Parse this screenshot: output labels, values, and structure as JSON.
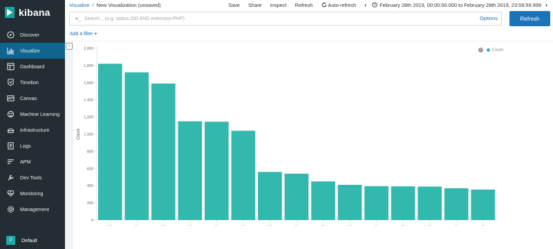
{
  "brand": {
    "name": "kibana"
  },
  "sidebar": {
    "items": [
      {
        "label": "Discover",
        "icon": "compass-icon",
        "active": false
      },
      {
        "label": "Visualize",
        "icon": "chart-icon",
        "active": true
      },
      {
        "label": "Dashboard",
        "icon": "dashboard-icon",
        "active": false
      },
      {
        "label": "Timelion",
        "icon": "timelion-icon",
        "active": false
      },
      {
        "label": "Canvas",
        "icon": "canvas-icon",
        "active": false
      },
      {
        "label": "Machine Learning",
        "icon": "machine-learning-icon",
        "active": false
      },
      {
        "label": "Infrastructure",
        "icon": "infrastructure-icon",
        "active": false
      },
      {
        "label": "Logs",
        "icon": "logs-icon",
        "active": false
      },
      {
        "label": "APM",
        "icon": "apm-icon",
        "active": false
      },
      {
        "label": "Dev Tools",
        "icon": "wrench-icon",
        "active": false
      },
      {
        "label": "Monitoring",
        "icon": "heartbeat-icon",
        "active": false
      },
      {
        "label": "Management",
        "icon": "gear-icon",
        "active": false
      }
    ],
    "space": {
      "avatar": "D",
      "label": "Default"
    }
  },
  "header": {
    "breadcrumb_root": "Visualize",
    "breadcrumb_sep": "/",
    "breadcrumb_current": "New Visualization (unsaved)",
    "save": "Save",
    "share": "Share",
    "inspect": "Inspect",
    "refresh": "Refresh",
    "auto_refresh": "Auto-refresh",
    "time_range": "February 28th 2019, 00:00:00.000 to February 28th 2019, 23:59:59.999"
  },
  "query": {
    "prompt": ">_",
    "placeholder": "Search... (e.g. status:200 AND extension:PHP)",
    "options": "Options",
    "refresh_button": "Refresh"
  },
  "filters": {
    "add_filter": "Add a filter",
    "add_symbol": "+"
  },
  "colors": {
    "bar": "#33b8ad",
    "sidebar": "#222e34",
    "active": "#10658f",
    "accent": "#1b73b8"
  },
  "chart_data": {
    "type": "bar",
    "ylabel": "Count",
    "ylim": [
      0,
      2000
    ],
    "yticks": [
      "0",
      "200",
      "400",
      "600",
      "800",
      "1,000",
      "1,200",
      "1,400",
      "1,600",
      "1,800",
      "2,000"
    ],
    "categories": [
      "—",
      "—",
      "—",
      "—",
      "—",
      "—",
      "—",
      "—",
      "—",
      "—",
      "—",
      "—",
      "—",
      "—",
      "—"
    ],
    "series": [
      {
        "name": "Count",
        "color": "#33b8ad",
        "values": [
          1820,
          1720,
          1590,
          1150,
          1145,
          1040,
          560,
          540,
          450,
          410,
          395,
          392,
          390,
          370,
          355
        ]
      }
    ],
    "legend": "top-right"
  }
}
